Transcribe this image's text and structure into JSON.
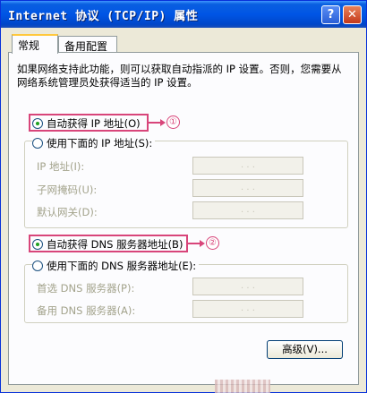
{
  "window": {
    "title": "Internet 协议 (TCP/IP) 属性",
    "help_label": "?",
    "close_label": "✕"
  },
  "tabs": [
    {
      "label": "常规",
      "active": true
    },
    {
      "label": "备用配置",
      "active": false
    }
  ],
  "description": "如果网络支持此功能，则可以获取自动指派的 IP 设置。否则，您需要从网络系统管理员处获得适当的 IP 设置。",
  "ip": {
    "auto_label": "自动获得 IP 地址(O)",
    "auto_selected": true,
    "manual_label": "使用下面的 IP 地址(S):",
    "manual_selected": false,
    "fields": [
      {
        "label": "IP 地址(I):",
        "value": ". . ."
      },
      {
        "label": "子网掩码(U):",
        "value": ". . ."
      },
      {
        "label": "默认网关(D):",
        "value": ". . ."
      }
    ]
  },
  "dns": {
    "auto_label": "自动获得 DNS 服务器地址(B)",
    "auto_selected": true,
    "manual_label": "使用下面的 DNS 服务器地址(E):",
    "manual_selected": false,
    "fields": [
      {
        "label": "首选 DNS 服务器(P):",
        "value": ". . ."
      },
      {
        "label": "备用 DNS 服务器(A):",
        "value": ". . ."
      }
    ]
  },
  "callouts": [
    "①",
    "②"
  ],
  "advanced_button": "高级(V)...",
  "colors": {
    "highlight": "#d8457a",
    "titlebar": "#0055e5",
    "radio_dot": "#21a121"
  }
}
